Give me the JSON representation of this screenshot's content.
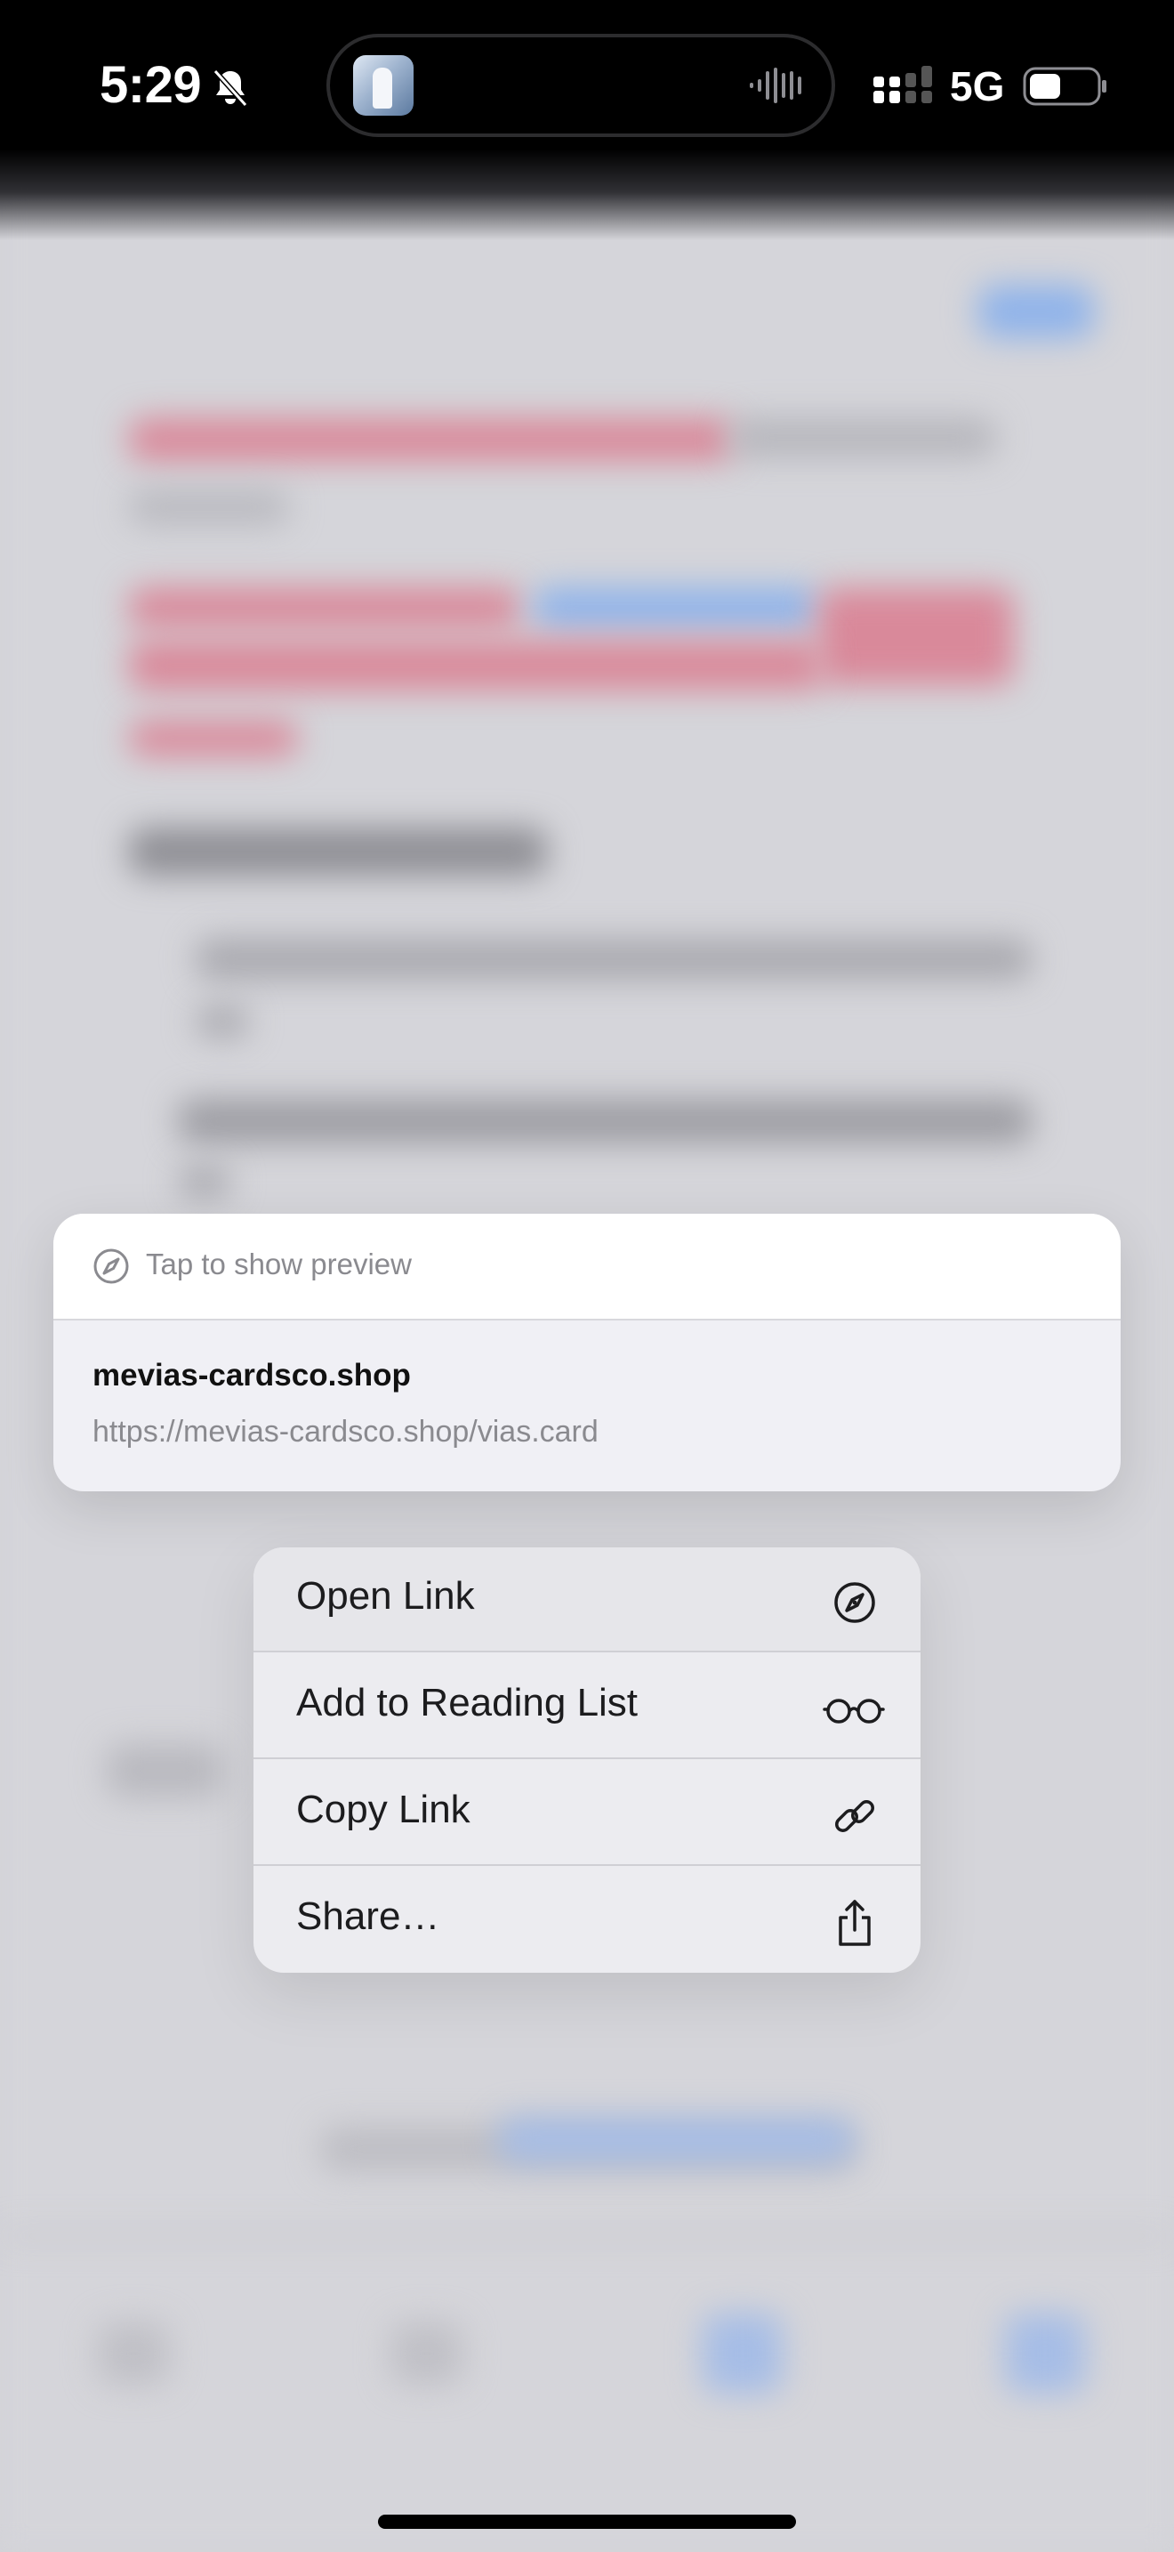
{
  "status_bar": {
    "time": "5:29",
    "network_type": "5G",
    "icons": [
      "bell-slash-icon",
      "audio-wave-icon",
      "cellular-signal-icon",
      "battery-icon"
    ]
  },
  "preview": {
    "tap_to_show": "Tap to show preview",
    "domain": "mevias-cardsco.shop",
    "url": "https://mevias-cardsco.shop/vias.card",
    "icon": "compass-icon"
  },
  "menu": {
    "items": [
      {
        "label": "Open Link",
        "icon": "compass-icon"
      },
      {
        "label": "Add to Reading List",
        "icon": "glasses-icon"
      },
      {
        "label": "Copy Link",
        "icon": "link-icon"
      },
      {
        "label": "Share…",
        "icon": "share-icon"
      }
    ]
  }
}
